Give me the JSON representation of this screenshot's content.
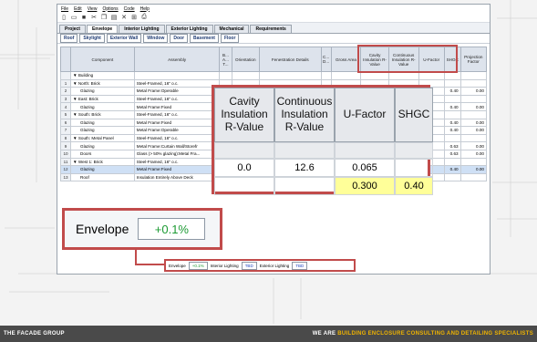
{
  "menu": [
    "File",
    "Edit",
    "View",
    "Options",
    "Code",
    "Help"
  ],
  "main_tabs": [
    {
      "label": "Project",
      "active": false
    },
    {
      "label": "Envelope",
      "active": true
    },
    {
      "label": "Interior Lighting",
      "active": false
    },
    {
      "label": "Exterior Lighting",
      "active": false
    },
    {
      "label": "Mechanical",
      "active": false
    },
    {
      "label": "Requirements",
      "active": false
    }
  ],
  "sub_tabs": [
    "Roof",
    "Skylight",
    "Exterior Wall",
    "Window",
    "Door",
    "Basement",
    "Floor"
  ],
  "table": {
    "headers": [
      "",
      "Component",
      "Assembly",
      "B... A... T...",
      "Orientation",
      "Fenestration Details",
      "C... D...",
      "Gross Area",
      "Cavity Insulation R-Value",
      "Continuous Insulation R-Value",
      "U-Factor",
      "SHGC",
      "Projection Factor"
    ],
    "rows": [
      {
        "num": "",
        "component": "▼ Building",
        "assembly": "",
        "ufactor": "",
        "shgc": "",
        "proj": ""
      },
      {
        "num": "1",
        "component": "▼ North: Brick",
        "assembly": "Steel-Framed, 16\" o.c.",
        "ufactor": "",
        "shgc": "",
        "proj": ""
      },
      {
        "num": "2",
        "component": "Glazing",
        "assembly": "Metal Frame:Operable",
        "ufactor": "",
        "shgc": "0.40",
        "proj": "0.00"
      },
      {
        "num": "3",
        "component": "▼ East: Brick",
        "assembly": "Steel-Framed, 16\" o.c.",
        "ufactor": "",
        "shgc": "",
        "proj": ""
      },
      {
        "num": "4",
        "component": "Glazing",
        "assembly": "Metal Frame:Fixed",
        "ufactor": "",
        "shgc": "0.40",
        "proj": "0.00"
      },
      {
        "num": "5",
        "component": "▼ South: Brick",
        "assembly": "Steel-Framed, 16\" o.c.",
        "ufactor": "",
        "shgc": "",
        "proj": ""
      },
      {
        "num": "6",
        "component": "Glazing",
        "assembly": "Metal Frame:Fixed",
        "ufactor": "",
        "shgc": "0.40",
        "proj": "0.00"
      },
      {
        "num": "7",
        "component": "Glazing",
        "assembly": "Metal Frame:Operable",
        "ufactor": "",
        "shgc": "0.40",
        "proj": "0.00"
      },
      {
        "num": "8",
        "component": "▼ South: Metal Panel",
        "assembly": "Steel-Framed, 16\" o.c.",
        "ufactor": "",
        "shgc": "",
        "proj": ""
      },
      {
        "num": "9",
        "component": "Glazing",
        "assembly": "Metal Frame:Curtain Wall/Storefr",
        "ufactor": "",
        "shgc": "0.63",
        "proj": "0.00"
      },
      {
        "num": "10",
        "component": "Doors",
        "assembly": "Glass (> 50% glazing):Metal Fra...",
        "ufactor": "",
        "shgc": "0.63",
        "proj": "0.00"
      },
      {
        "num": "11",
        "component": "▼ West 1: Brick",
        "assembly": "Steel-Framed, 16\" o.c.",
        "ufactor": "",
        "shgc": "",
        "proj": ""
      },
      {
        "num": "12",
        "component": "Glazing",
        "assembly": "Metal Frame:Fixed",
        "ufactor": "",
        "shgc": "0.40",
        "proj": "0.00",
        "selected": true
      },
      {
        "num": "13",
        "component": "Roof",
        "assembly": "Insulation Entirely Above Deck",
        "ufactor": "",
        "shgc": "",
        "proj": ""
      }
    ]
  },
  "zoom": {
    "headers": [
      "Cavity Insulation R-Value",
      "Continuous Insulation R-Value",
      "U-Factor",
      "SHGC"
    ],
    "row1": [
      "0.0",
      "12.6",
      "0.065",
      ""
    ],
    "row2": [
      "",
      "",
      "0.300",
      "0.40"
    ]
  },
  "envelope_callout": {
    "label": "Envelope",
    "value": "+0.1%"
  },
  "statusbar": {
    "envelope_label": "Envelope",
    "envelope_value": "+0.1%",
    "interior_label": "Interior Lighting",
    "interior_value": "TBD",
    "exterior_label": "Exterior Lighting",
    "exterior_value": "TBD"
  },
  "footer": {
    "left": "THE FACADE GROUP",
    "right_prefix": "WE ARE ",
    "right_accent": "BUILDING ENCLOSURE CONSULTING AND DETAILING",
    "right_suffix": " SPECIALISTS"
  },
  "colors": {
    "highlight": "#c14b4b",
    "positive": "#1b9a32",
    "tbd": "#1f47c1",
    "accent": "#f0b400"
  }
}
